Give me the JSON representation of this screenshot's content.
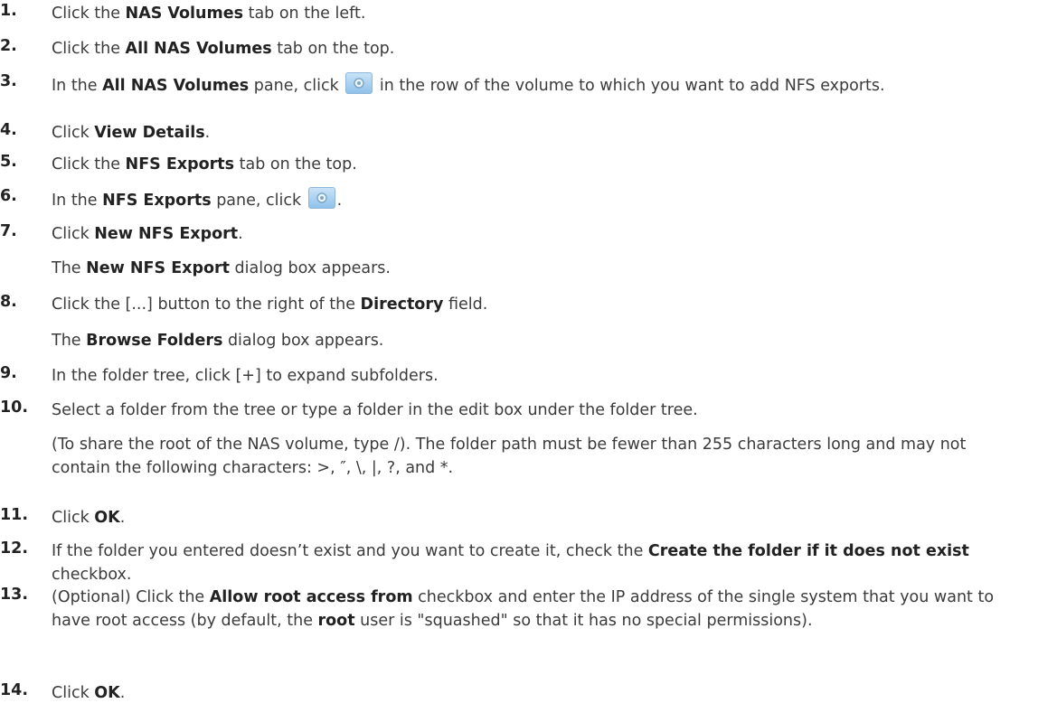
{
  "steps": [
    {
      "num": "1.",
      "parts": [
        {
          "t": "Click the "
        },
        {
          "b": "NAS Volumes"
        },
        {
          "t": " tab on the left."
        }
      ]
    },
    {
      "num": "2.",
      "parts": [
        {
          "t": "Click the "
        },
        {
          "b": "All NAS Volumes"
        },
        {
          "t": " tab on the top."
        }
      ]
    },
    {
      "num": "3.",
      "parts": [
        {
          "t": "In the "
        },
        {
          "b": "All NAS Volumes"
        },
        {
          "t": " pane, click "
        },
        {
          "icon": "gear-icon"
        },
        {
          "t": " in the row of the volume to which you want to add NFS exports."
        }
      ]
    },
    {
      "num": "4.",
      "parts": [
        {
          "t": "Click "
        },
        {
          "b": "View Details"
        },
        {
          "t": "."
        }
      ]
    },
    {
      "num": "5.",
      "parts": [
        {
          "t": "Click the "
        },
        {
          "b": "NFS Exports"
        },
        {
          "t": " tab on the top."
        }
      ]
    },
    {
      "num": "6.",
      "parts": [
        {
          "t": "In the "
        },
        {
          "b": "NFS Exports"
        },
        {
          "t": " pane, click "
        },
        {
          "icon": "gear-icon"
        },
        {
          "t": "."
        }
      ]
    },
    {
      "num": "7.",
      "parts": [
        {
          "t": "Click "
        },
        {
          "b": "New NFS Export"
        },
        {
          "t": "."
        }
      ],
      "note": [
        {
          "t": "The "
        },
        {
          "b": "New NFS Export"
        },
        {
          "t": " dialog box appears."
        }
      ]
    },
    {
      "num": "8.",
      "parts": [
        {
          "t": "Click the [...] button to the right of the "
        },
        {
          "b": "Directory"
        },
        {
          "t": " field."
        }
      ],
      "note": [
        {
          "t": "The "
        },
        {
          "b": "Browse Folders"
        },
        {
          "t": " dialog box appears."
        }
      ]
    },
    {
      "num": "9.",
      "parts": [
        {
          "t": "In the folder tree, click [+] to expand subfolders."
        }
      ]
    },
    {
      "num": "10.",
      "parts": [
        {
          "t": "Select a folder from the tree or type a folder in the edit box under the folder tree."
        }
      ],
      "note": [
        {
          "t": "(To share the root of the NAS volume, type /). The folder path must be fewer than 255 characters long and may not contain the following characters: >, ″, \\, |, ?, and *."
        }
      ]
    },
    {
      "num": "11.",
      "parts": [
        {
          "t": "Click "
        },
        {
          "b": "OK"
        },
        {
          "t": "."
        }
      ]
    },
    {
      "num": "12.",
      "parts": [
        {
          "t": "If the folder you entered doesn’t exist and you want to create it, check the "
        },
        {
          "b": "Create the folder if it does not exist"
        },
        {
          "t": " checkbox."
        }
      ]
    },
    {
      "num": "13.",
      "parts": [
        {
          "t": "(Optional) Click the "
        },
        {
          "b": "Allow root access from"
        },
        {
          "t": " checkbox and enter the IP address of the single system that you want to have root access (by default, the "
        },
        {
          "b": "root"
        },
        {
          "t": " user is \"squashed\" so that it has no special permissions)."
        }
      ]
    },
    {
      "num": "14.",
      "parts": [
        {
          "t": "Click "
        },
        {
          "b": "OK"
        },
        {
          "t": "."
        }
      ]
    }
  ]
}
